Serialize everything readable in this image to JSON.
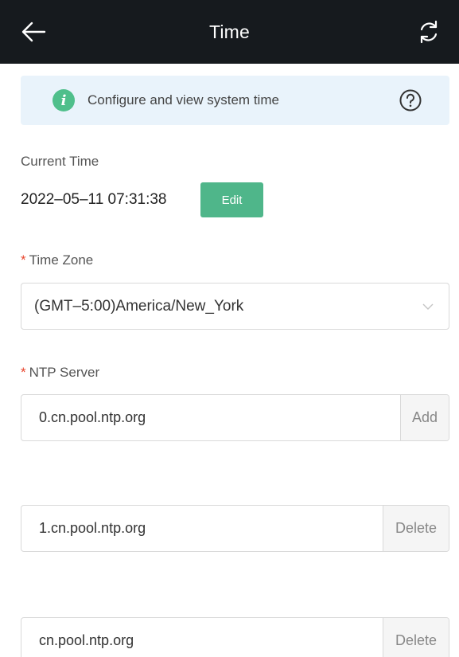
{
  "header": {
    "title": "Time",
    "back_icon": "arrow-left-icon",
    "refresh_icon": "refresh-icon"
  },
  "banner": {
    "text": "Configure and view system time",
    "info_icon": "info-icon",
    "help_icon": "question-circle-icon",
    "background": "#e9f3fb",
    "icon_color": "#4fbf8b"
  },
  "current_time": {
    "label": "Current Time",
    "value": "2022–05–11 07:31:38",
    "edit_label": "Edit"
  },
  "time_zone": {
    "required_mark": "*",
    "label": "Time Zone",
    "selected": "(GMT–5:00)America/New_York"
  },
  "ntp": {
    "required_mark": "*",
    "label": "NTP Server",
    "servers": [
      {
        "value": "0.cn.pool.ntp.org",
        "action": "Add"
      },
      {
        "value": "1.cn.pool.ntp.org",
        "action": "Delete"
      },
      {
        "value": "cn.pool.ntp.org",
        "action": "Delete"
      }
    ]
  },
  "colors": {
    "header_bg": "#161a1e",
    "accent_green": "#4fb68a",
    "required_red": "#e8462e"
  }
}
